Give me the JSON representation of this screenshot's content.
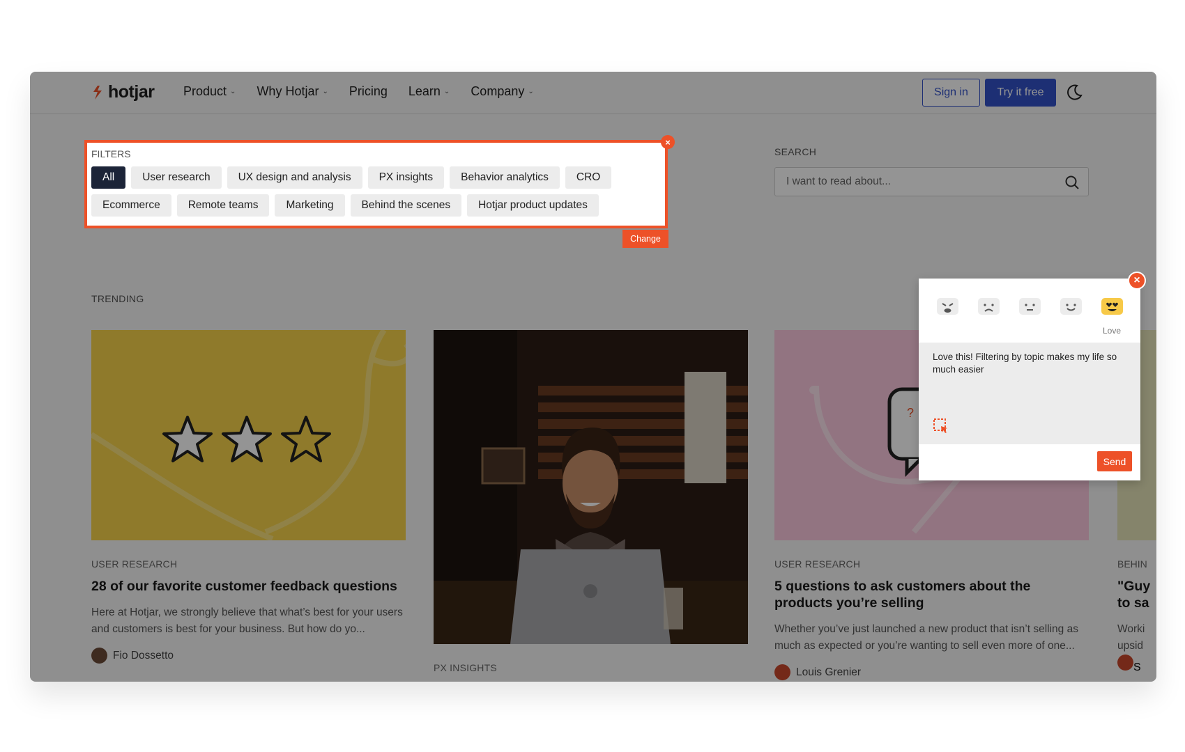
{
  "header": {
    "logo_text": "hotjar",
    "nav": [
      {
        "label": "Product"
      },
      {
        "label": "Why Hotjar"
      },
      {
        "label": "Pricing"
      },
      {
        "label": "Learn"
      },
      {
        "label": "Company"
      }
    ],
    "signin_label": "Sign in",
    "try_label": "Try it free"
  },
  "filters": {
    "label": "FILTERS",
    "chips": [
      "All",
      "User research",
      "UX design and analysis",
      "PX insights",
      "Behavior analytics",
      "CRO",
      "Ecommerce",
      "Remote teams",
      "Marketing",
      "Behind the scenes",
      "Hotjar product updates"
    ],
    "active": "All",
    "change_label": "Change"
  },
  "search": {
    "label": "SEARCH",
    "placeholder": "I want to read about..."
  },
  "trending": {
    "label": "TRENDING",
    "cards": [
      {
        "category": "USER RESEARCH",
        "title": "28 of our favorite customer feedback questions",
        "excerpt": "Here at Hotjar, we strongly believe that what’s best for your users and customers is best for your business. But how do yo...",
        "author": "Fio Dossetto"
      },
      {
        "category": "PX INSIGHTS"
      },
      {
        "category": "USER RESEARCH",
        "title": "5 questions to ask customers about the products you’re selling",
        "excerpt": "Whether you’ve just launched a new product that isn’t selling as much as expected or you’re wanting to sell even more of one...",
        "author": "Louis Grenier"
      },
      {
        "category": "BEHIN",
        "title_line1": "\"Guy",
        "title_line2": "to sa",
        "excerpt_line1": "Worki",
        "excerpt_line2": "upsid",
        "author": "S"
      }
    ]
  },
  "feedback": {
    "selected_rating": "Love",
    "text": "Love this! Filtering by topic makes my life so much easier",
    "send_label": "Send"
  },
  "colors": {
    "accent": "#ed5128",
    "brand": "#3251c9",
    "chip_active": "#1c2438"
  }
}
